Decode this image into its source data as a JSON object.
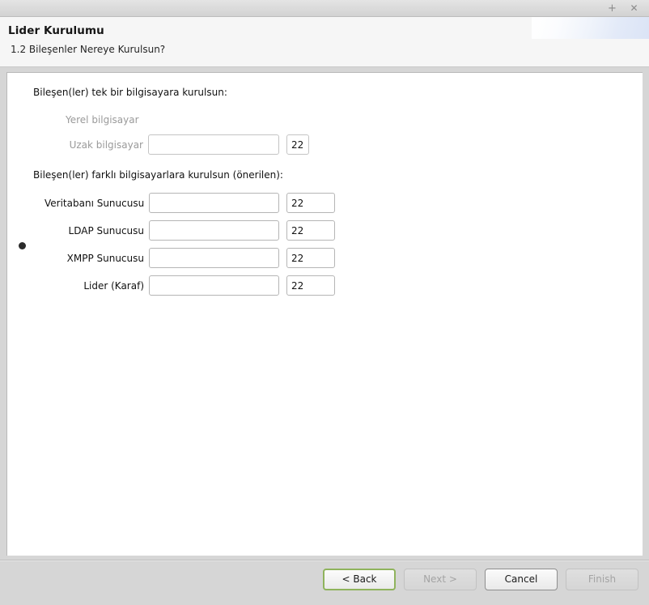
{
  "window": {
    "titlebar": {
      "maximize_label": "+",
      "close_label": "✕"
    }
  },
  "header": {
    "title": "Lider Kurulumu",
    "subtitle": "1.2 Bileşenler Nereye Kurulsun?"
  },
  "form": {
    "option_single": {
      "heading": "Bileşen(ler) tek bir bilgisayara kurulsun:",
      "selected": false,
      "rows": [
        {
          "label": "Yerel bilgisayar",
          "has_host_input": false,
          "has_port_input": false,
          "host_value": "",
          "port_value": "",
          "disabled": true
        },
        {
          "label": "Uzak bilgisayar",
          "has_host_input": true,
          "has_port_input": true,
          "host_value": "",
          "port_value": "22",
          "disabled": true
        }
      ]
    },
    "option_multi": {
      "heading": "Bileşen(ler) farklı bilgisayarlara kurulsun (önerilen):",
      "selected": true,
      "rows": [
        {
          "label": "Veritabanı Sunucusu",
          "host_value": "",
          "port_value": "22",
          "disabled": false
        },
        {
          "label": "LDAP Sunucusu",
          "host_value": "",
          "port_value": "22",
          "disabled": false
        },
        {
          "label": "XMPP Sunucusu",
          "host_value": "",
          "port_value": "22",
          "disabled": false
        },
        {
          "label": "Lider (Karaf)",
          "host_value": "",
          "port_value": "22",
          "disabled": false
        }
      ]
    }
  },
  "footer": {
    "buttons": [
      {
        "label": "< Back",
        "state": "focused"
      },
      {
        "label": "Next >",
        "state": "disabled"
      },
      {
        "label": "Cancel",
        "state": "normal"
      },
      {
        "label": "Finish",
        "state": "disabled"
      }
    ]
  },
  "colors": {
    "focus_green": "#8fb35c",
    "window_chrome": "#d6d6d6",
    "panel_bg": "#ffffff",
    "header_bg": "#f6f6f6",
    "disabled_text": "#9a9a9a"
  }
}
